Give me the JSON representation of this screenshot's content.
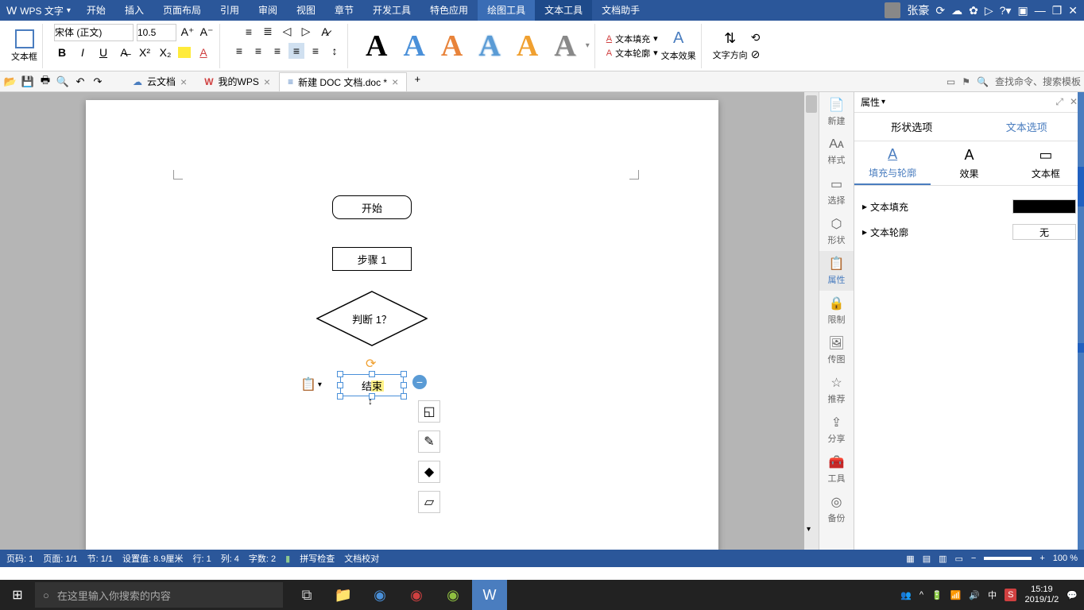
{
  "app": {
    "name": "WPS 文字"
  },
  "user": {
    "name": "张豪"
  },
  "menuTabs": [
    "开始",
    "插入",
    "页面布局",
    "引用",
    "审阅",
    "视图",
    "章节",
    "开发工具",
    "特色应用",
    "绘图工具",
    "文本工具",
    "文档助手"
  ],
  "activeMenuIdx": 10,
  "highlightMenuIdx": 9,
  "ribbon": {
    "textboxLabel": "文本框",
    "fontName": "宋体 (正文)",
    "fontSize": "10.5",
    "fillLabel": "文本填充",
    "outlineLabel": "文本轮廓",
    "effectLabel": "文本效果",
    "directionLabel": "文字方向"
  },
  "docTabs": [
    {
      "label": "云文档",
      "icon": "☁"
    },
    {
      "label": "我的WPS",
      "icon": "W"
    },
    {
      "label": "新建 DOC 文档.doc *",
      "icon": "≡",
      "active": true
    }
  ],
  "searchPlaceholder": "查找命令、搜索模板",
  "shapes": {
    "start": "开始",
    "step1": "步骤 1",
    "decision": "判断 1？",
    "end": "结束"
  },
  "sideToolbar": [
    "新建",
    "样式",
    "选择",
    "形状",
    "属性",
    "限制",
    "传图",
    "推荐",
    "分享",
    "工具",
    "备份"
  ],
  "activeSideIdx": 4,
  "propsPanel": {
    "title": "属性",
    "tabs": [
      "形状选项",
      "文本选项"
    ],
    "activeTab": 1,
    "subtabs": [
      "填充与轮廓",
      "效果",
      "文本框"
    ],
    "activeSubtab": 0,
    "fillLabel": "文本填充",
    "outlineLabel": "文本轮廓",
    "outlineValue": "无"
  },
  "statusBar": {
    "page": "页码: 1",
    "pages": "页面: 1/1",
    "section": "节: 1/1",
    "setval": "设置值: 8.9厘米",
    "line": "行: 1",
    "col": "列: 4",
    "words": "字数: 2",
    "spell": "拼写检查",
    "proof": "文档校对",
    "zoom": "100 %"
  },
  "taskbar": {
    "searchPlaceholder": "在这里输入你搜索的内容",
    "time": "15:19",
    "date": "2019/1/2",
    "ime": "中"
  }
}
